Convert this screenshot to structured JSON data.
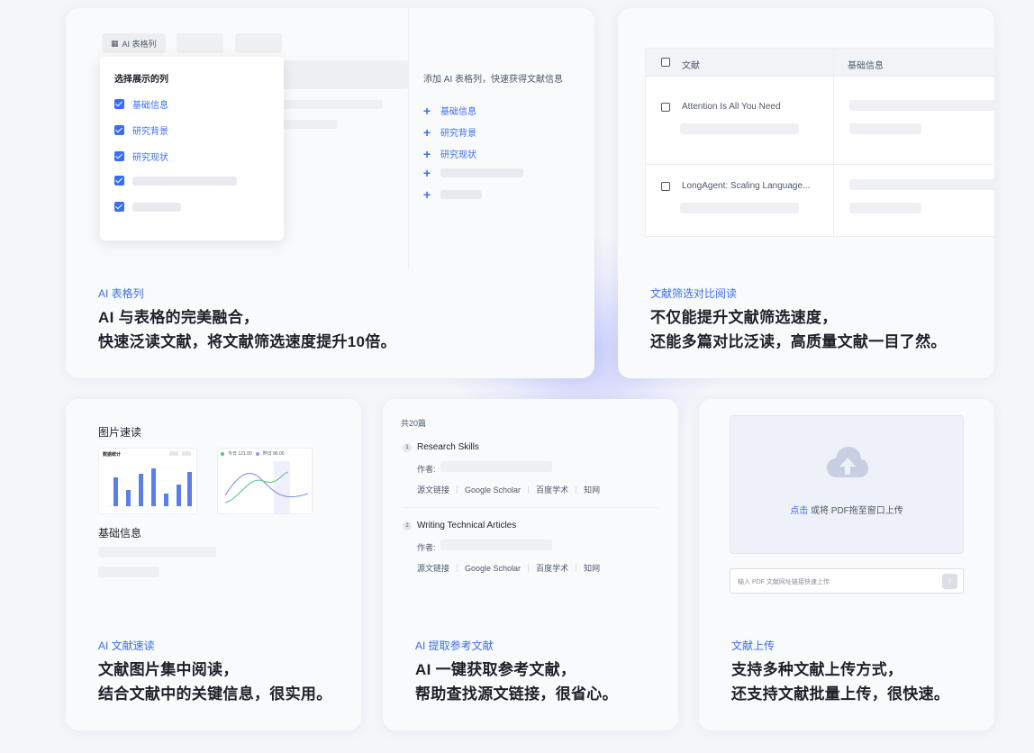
{
  "card_ai_table": {
    "toolbar_label": "AI 表格列",
    "panel_title": "选择展示的列",
    "checked_items": [
      "基础信息",
      "研究背景",
      "研究现状"
    ],
    "right_title": "添加 AI 表格列，快速获得文献信息",
    "add_items": [
      "基础信息",
      "研究背景",
      "研究现状"
    ],
    "tag": "AI 表格列",
    "headline_1": "AI 与表格的完美融合，",
    "headline_2": "快速泛读文献，将文献筛选速度提升10倍。"
  },
  "card_compare": {
    "col_doc": "文献",
    "col_basic": "基础信息",
    "rows": [
      "Attention Is All You Need",
      "LongAgent: Scaling Language..."
    ],
    "tag": "文献筛选对比阅读",
    "headline_1": "不仅能提升文献筛选速度，",
    "headline_2": "还能多篇对比泛读，高质量文献一目了然。"
  },
  "card_quick_read": {
    "label_images": "图片速读",
    "chart_title": "数据统计",
    "legend_a": "今日 121.00",
    "legend_b": "昨日 86.00",
    "label_basic": "基础信息",
    "tag": "AI 文献速读",
    "headline_1": "文献图片集中阅读，",
    "headline_2": "结合文献中的关键信息，很实用。"
  },
  "card_refs": {
    "count": "共20篇",
    "refs": [
      {
        "num": "1",
        "title": "Research Skills",
        "author_label": "作者:"
      },
      {
        "num": "2",
        "title": "Writing Technical Articles",
        "author_label": "作者:"
      }
    ],
    "links": [
      "源文链接",
      "Google Scholar",
      "百度学术",
      "知网"
    ],
    "tag": "AI 提取参考文献",
    "headline_1": "AI 一键获取参考文献，",
    "headline_2": "帮助查找源文链接，很省心。"
  },
  "card_upload": {
    "click_label": "点击",
    "drop_text": "或将 PDF拖至窗口上传",
    "input_placeholder": "输入 PDF 文献网址链接快速上传",
    "tag": "文献上传",
    "headline_1": "支持多种文献上传方式，",
    "headline_2": "还支持文献批量上传，很快速。"
  },
  "colors": {
    "accent": "#3b6ef6",
    "text": "#1d2129",
    "muted": "#4e5969",
    "card_bg": "#f9fafc"
  }
}
